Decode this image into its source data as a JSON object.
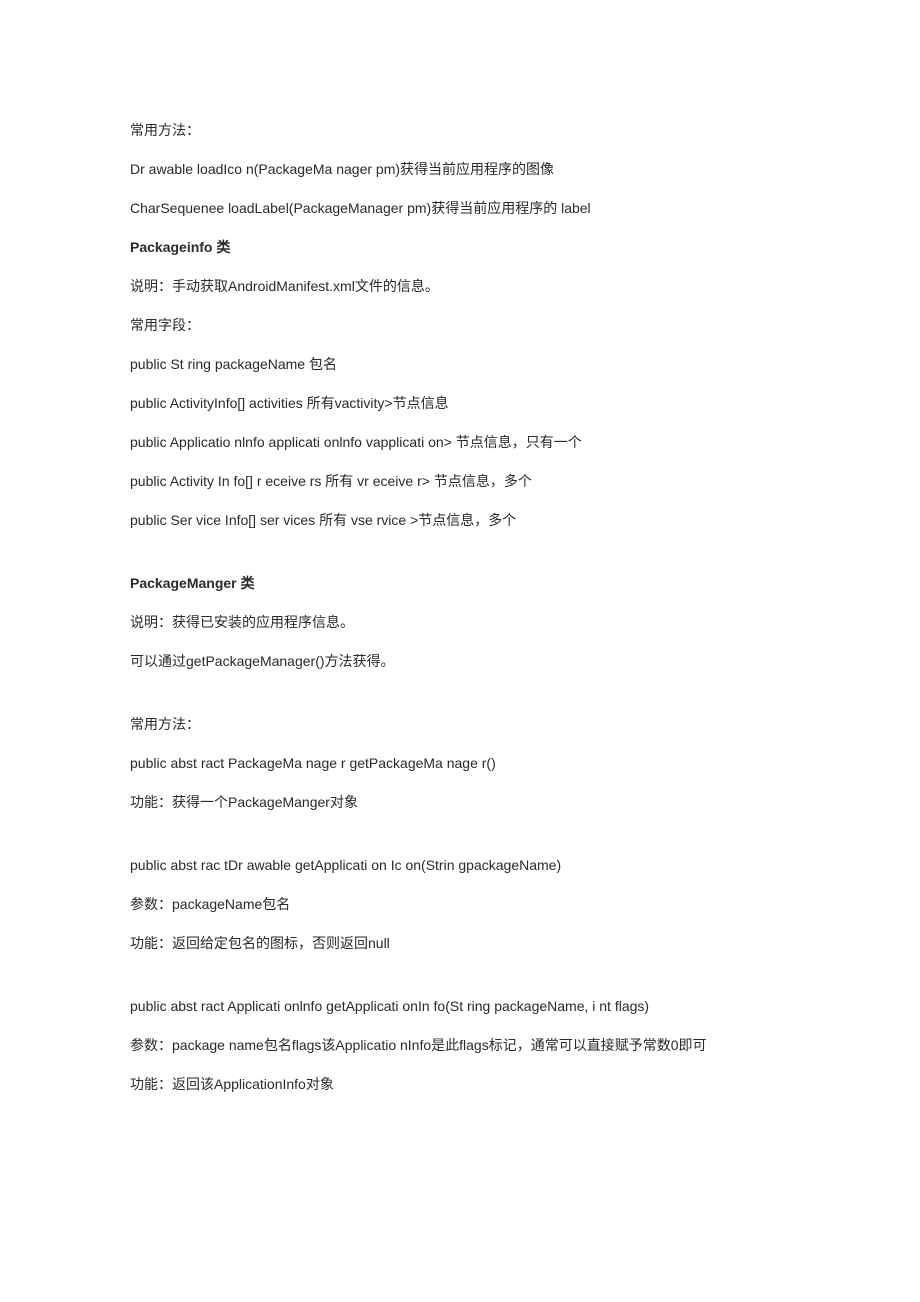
{
  "lines": [
    {
      "text": "常用方法：",
      "bold": false
    },
    {
      "text": "Dr awable loadIco n(PackageMa nager pm)获得当前应用程序的图像",
      "bold": false
    },
    {
      "text": "CharSequenee loadLabel(PackageManager pm)获得当前应用程序的  label",
      "bold": false
    },
    {
      "text": "Packageinfo 类",
      "bold": true
    },
    {
      "text": "说明：手动获取AndroidManifest.xml文件的信息。",
      "bold": false
    },
    {
      "text": "常用字段：",
      "bold": false
    },
    {
      "text": "public St ring packageName 包名",
      "bold": false
    },
    {
      "text": "public ActivityInfo[] activities 所有vactivity>节点信息",
      "bold": false
    },
    {
      "text": "public Applicatio nlnfo applicati onlnfo vapplicati on> 节点信息，只有一个",
      "bold": false
    },
    {
      "text": "public Activity In fo[] r eceive rs 所有  vr eceive r> 节点信息，多个",
      "bold": false
    },
    {
      "text": "public Ser vice Info[] ser vices 所有  vse rvice >节点信息，多个",
      "bold": false
    },
    {
      "text": "",
      "bold": false,
      "spacer": true
    },
    {
      "text": "PackageManger 类",
      "bold": true
    },
    {
      "text": "说明：获得已安装的应用程序信息。",
      "bold": false
    },
    {
      "text": "可以通过getPackageManager()方法获得。",
      "bold": false
    },
    {
      "text": "",
      "bold": false,
      "spacer": true
    },
    {
      "text": "常用方法：",
      "bold": false
    },
    {
      "text": "public abst ract PackageMa nage r getPackageMa nage r()",
      "bold": false
    },
    {
      "text": "功能：获得一个PackageManger对象",
      "bold": false
    },
    {
      "text": "",
      "bold": false,
      "spacer": true
    },
    {
      "text": "public abst rac tDr awable getApplicati on Ic on(Strin gpackageName)",
      "bold": false
    },
    {
      "text": "参数：packageName包名",
      "bold": false
    },
    {
      "text": "功能：返回给定包名的图标，否则返回null",
      "bold": false
    },
    {
      "text": "",
      "bold": false,
      "spacer": true
    },
    {
      "text": "public abst ract Applicati onlnfo getApplicati onIn fo(St ring packageName, i nt flags)",
      "bold": false
    },
    {
      "text": "参数：package name包名flags该Applicatio nInfo是此flags标记，通常可以直接赋予常数0即可",
      "bold": false
    },
    {
      "text": "功能：返回该ApplicationInfo对象",
      "bold": false
    }
  ]
}
